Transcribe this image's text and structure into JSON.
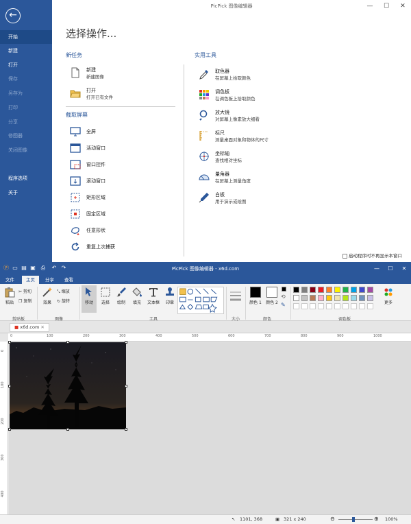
{
  "start_window": {
    "title": "PicPick 图像编辑器",
    "window_controls": [
      "—",
      "☐",
      "✕"
    ],
    "sidebar": {
      "items": [
        {
          "label": "开始",
          "state": "active"
        },
        {
          "label": "新建",
          "state": "normal"
        },
        {
          "label": "打开",
          "state": "normal"
        },
        {
          "label": "保存",
          "state": "disabled"
        },
        {
          "label": "另存为",
          "state": "disabled"
        },
        {
          "label": "打印",
          "state": "disabled"
        },
        {
          "label": "分享",
          "state": "disabled"
        },
        {
          "label": "修图器",
          "state": "disabled"
        },
        {
          "label": "关闭图像",
          "state": "disabled"
        },
        {
          "label": "程序选项",
          "state": "normal"
        },
        {
          "label": "关于",
          "state": "normal"
        }
      ]
    },
    "heading": "选择操作...",
    "new_task": {
      "title": "新任务",
      "items": [
        {
          "label": "新建",
          "desc": "新建图像",
          "icon": "blank-page-icon"
        },
        {
          "label": "打开",
          "desc": "打开已有文件",
          "icon": "folder-open-icon"
        }
      ]
    },
    "capture": {
      "title": "截取屏幕",
      "items": [
        {
          "label": "全屏",
          "icon": "monitor-icon"
        },
        {
          "label": "活动窗口",
          "icon": "window-icon"
        },
        {
          "label": "窗口控件",
          "icon": "window-control-icon"
        },
        {
          "label": "滚动窗口",
          "icon": "scroll-window-icon"
        },
        {
          "label": "矩形区域",
          "icon": "rect-region-icon"
        },
        {
          "label": "固定区域",
          "icon": "fixed-region-icon"
        },
        {
          "label": "任意形状",
          "icon": "freehand-icon"
        },
        {
          "label": "重复上次捕获",
          "icon": "repeat-icon"
        }
      ]
    },
    "tools": {
      "title": "实用工具",
      "items": [
        {
          "label": "取色器",
          "desc": "在屏幕上拾取颜色",
          "icon": "eyedropper-icon"
        },
        {
          "label": "调色板",
          "desc": "在调色板上拾取颜色",
          "icon": "palette-icon"
        },
        {
          "label": "放大镜",
          "desc": "对屏幕上像素放大细看",
          "icon": "magnifier-icon"
        },
        {
          "label": "标尺",
          "desc": "测量桌面对象和物体的尺寸",
          "icon": "ruler-icon"
        },
        {
          "label": "坐标轴",
          "desc": "查找相对坐标",
          "icon": "crosshair-icon"
        },
        {
          "label": "量角器",
          "desc": "在屏幕上测量角度",
          "icon": "protractor-icon"
        },
        {
          "label": "白板",
          "desc": "用于演示或绘图",
          "icon": "pen-icon"
        }
      ]
    },
    "startup_checkbox": "启动程序时不再显示本窗口"
  },
  "editor_window": {
    "title": "PicPick 图像编辑器 - x6d.com",
    "window_controls": [
      "—",
      "☐",
      "✕"
    ],
    "tabs": [
      {
        "label": "文件",
        "active": false
      },
      {
        "label": "主页",
        "active": true
      },
      {
        "label": "分享",
        "active": false
      },
      {
        "label": "查看",
        "active": false
      }
    ],
    "ribbon": {
      "clipboard": {
        "label": "剪贴板",
        "paste": "粘贴",
        "cut": "剪切",
        "copy": "复制"
      },
      "image": {
        "label": "图像",
        "effects": "效果",
        "resize": "缩放",
        "rotate": "旋转"
      },
      "tools": {
        "label": "工具",
        "items": [
          "移动",
          "选择",
          "绘制",
          "填充",
          "文本框",
          "印章"
        ]
      },
      "size": {
        "label": "大小"
      },
      "colors": {
        "label": "颜色",
        "color1": "颜色 1",
        "color2": "颜色 2"
      },
      "palette": {
        "label": "调色板",
        "more": "更多"
      },
      "palette_colors": [
        "#000000",
        "#7f7f7f",
        "#880015",
        "#ed1c24",
        "#ff7f27",
        "#fff200",
        "#22b14c",
        "#00a2e8",
        "#3f48cc",
        "#a349a4",
        "#ffffff",
        "#c3c3c3",
        "#b97a57",
        "#ffaec9",
        "#ffc90e",
        "#efe4b0",
        "#b5e61d",
        "#99d9ea",
        "#7092be",
        "#c8bfe7"
      ]
    },
    "document_tab": "x6d.com",
    "ruler_top": [
      "0",
      "100",
      "200",
      "300",
      "400",
      "500",
      "600",
      "700",
      "800",
      "900",
      "1000"
    ],
    "ruler_left": [
      "0",
      "100",
      "200",
      "300",
      "400"
    ],
    "status": {
      "cursor": "1101, 368",
      "size": "321 x 240",
      "zoom": "100%"
    }
  }
}
